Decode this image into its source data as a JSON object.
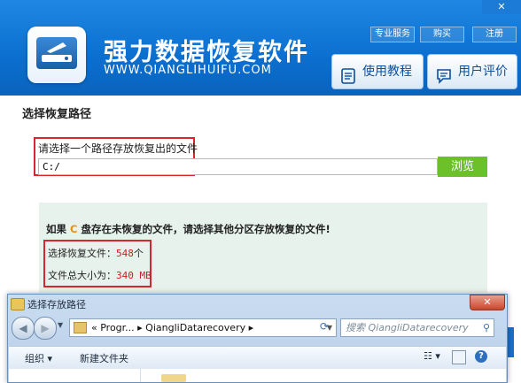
{
  "app": {
    "title": "强力数据恢复软件",
    "url": "WWW.QIANGLIHUIFU.COM",
    "top_links": [
      "专业服务",
      "购买",
      "注册"
    ],
    "buttons": {
      "tutorial": "使用教程",
      "feedback": "用户评价"
    },
    "brand_color": "#0b6fd0"
  },
  "main": {
    "section_title": "选择恢复路径",
    "path_prompt": "请选择一个路径存放恢复出的文件",
    "path_value": "C:/",
    "browse_label": "浏览",
    "warning": {
      "prefix": "如果 ",
      "drive": "C",
      "suffix": " 盘存在未恢复的文件，请选择其他分区存放恢复的文件!"
    },
    "selected_label": "选择恢复文件：",
    "selected_count": "548",
    "selected_unit": "个",
    "size_label": "文件总大小为：",
    "size_value": "340 MB"
  },
  "dialog": {
    "title": "选择存放路径",
    "breadcrumb": "«  Progr...  ▸  QiangliDatarecovery  ▸",
    "search_placeholder": "搜索 QiangliDatarecovery",
    "toolbar": {
      "organize": "组织 ▾",
      "new_folder": "新建文件夹",
      "view": "☷ ▾",
      "help": "?"
    }
  }
}
